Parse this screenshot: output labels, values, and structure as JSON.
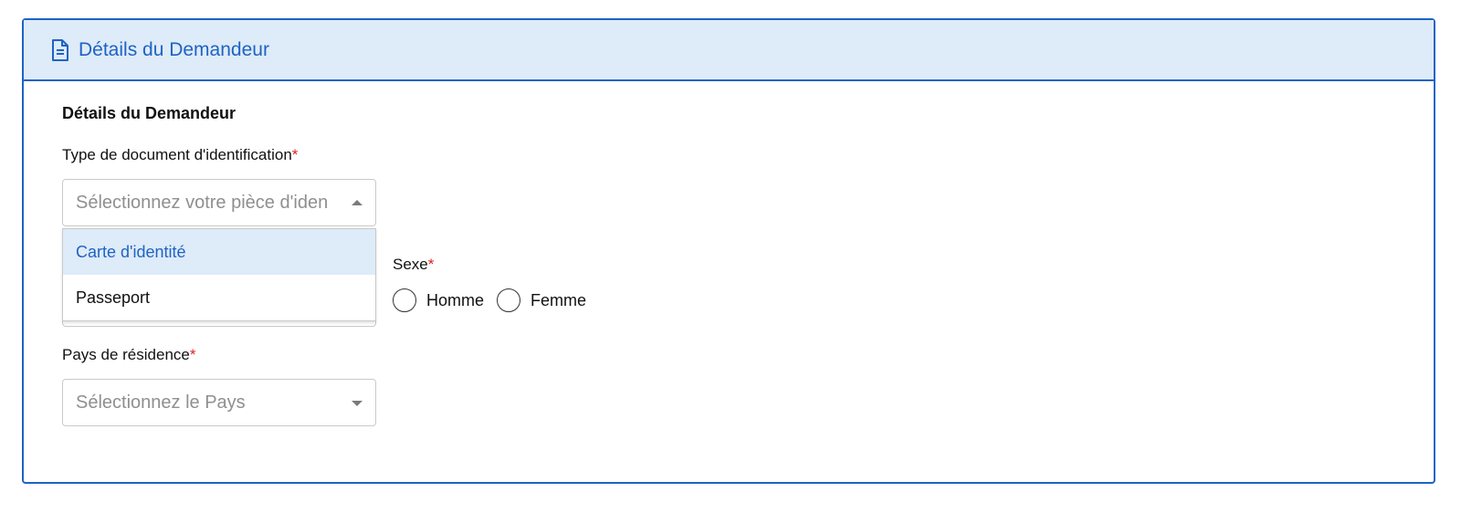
{
  "panel": {
    "header_title": "Détails du Demandeur",
    "section_title": "Détails du Demandeur"
  },
  "id_document": {
    "label": "Type de document d'identification",
    "required_mark": "*",
    "placeholder": "Sélectionnez votre pièce d'iden",
    "options": [
      {
        "label": "Carte d'identité",
        "highlighted": true
      },
      {
        "label": "Passeport",
        "highlighted": false
      }
    ]
  },
  "sex": {
    "label": "Sexe",
    "required_mark": "*",
    "options": [
      {
        "label": "Homme",
        "selected": false
      },
      {
        "label": "Femme",
        "selected": false
      }
    ]
  },
  "country": {
    "label": "Pays de résidence",
    "required_mark": "*",
    "placeholder": "Sélectionnez le Pays"
  },
  "colors": {
    "accent": "#1e63c4",
    "header_bg": "#deebf8",
    "required": "#e02020"
  },
  "icons": {
    "header_icon": "document-icon",
    "id_caret": "caret-up-icon",
    "country_caret": "caret-down-icon"
  }
}
